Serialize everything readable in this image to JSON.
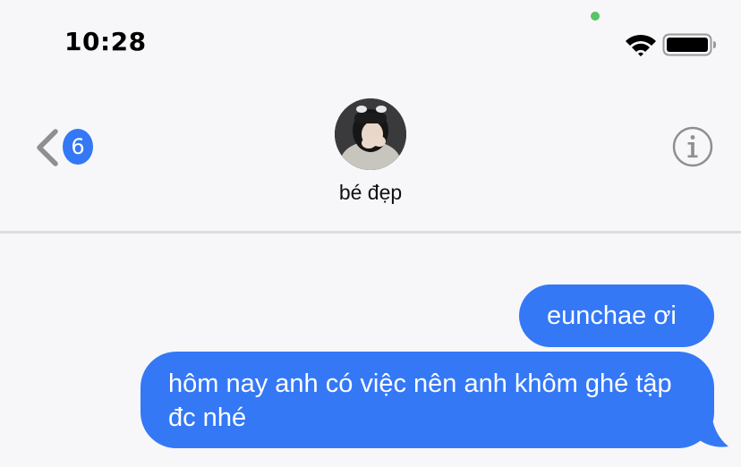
{
  "status_bar": {
    "time": "10:28",
    "icons": [
      "camera-in-use-dot",
      "wifi-icon",
      "battery-icon"
    ],
    "camera_dot_color": "#5ac466"
  },
  "nav": {
    "back_icon": "chevron-left-icon",
    "back_badge_count": "6",
    "contact_name": "bé đẹp",
    "info_icon": "info-icon"
  },
  "messages": [
    {
      "direction": "outgoing",
      "text": "eunchae ơi"
    },
    {
      "direction": "outgoing",
      "text": "hôm nay anh có việc nên anh khôm ghé tập đc nhé"
    }
  ],
  "colors": {
    "accent": "#3478f6",
    "background": "#f7f7f9",
    "divider": "#dcdce2",
    "icon_gray": "#8e8e93"
  }
}
